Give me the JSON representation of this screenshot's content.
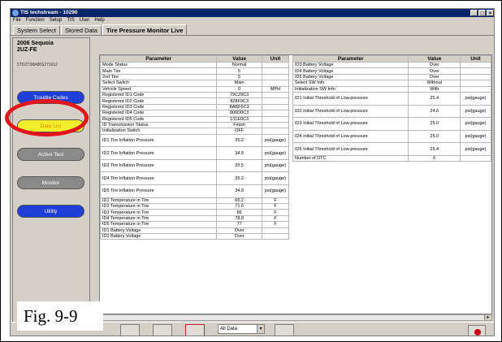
{
  "window": {
    "title": "TIS techstream - 10290"
  },
  "menu": [
    "File",
    "Function",
    "Setup",
    "TIS",
    "User",
    "Help"
  ],
  "tabs": [
    "System Select",
    "Stored Data",
    "Tire Pressure Monitor Live"
  ],
  "vehicle": {
    "name": "2006 Sequoia",
    "engine": "2UZ-FE",
    "vin": "5TDZT38A86S271612"
  },
  "side_buttons": [
    {
      "label": "Trouble Codes",
      "color": "#1f3fd8"
    },
    {
      "label": "Data List",
      "color": "#f1ef2b"
    },
    {
      "label": "Active Test",
      "color": "#8a8a8a"
    },
    {
      "label": "Monitor",
      "color": "#8a8a8a"
    },
    {
      "label": "Utility",
      "color": "#1f3fd8"
    }
  ],
  "headers": {
    "parameter": "Parameter",
    "value": "Value",
    "unit": "Unit"
  },
  "left_rows": [
    {
      "p": "Mode Status",
      "v": "Normal",
      "u": ""
    },
    {
      "p": "Main Tire",
      "v": "5",
      "u": ""
    },
    {
      "p": "2nd Tire",
      "v": "5",
      "u": ""
    },
    {
      "p": "Select Switch",
      "v": "Main",
      "u": ""
    },
    {
      "p": "Vehicle Speed",
      "v": "0",
      "u": "MPH"
    },
    {
      "p": "Registered ID1 Code",
      "v": "79C29C3",
      "u": ""
    },
    {
      "p": "Registered ID2 Code",
      "v": "828F9C3",
      "u": ""
    },
    {
      "p": "Registered ID3 Code",
      "v": "8ABF6C3",
      "u": ""
    },
    {
      "p": "Registered ID4 Code",
      "v": "806D0C3",
      "u": ""
    },
    {
      "p": "Registered ID5 Code",
      "v": "131E0C3",
      "u": ""
    },
    {
      "p": "ID Transmission Status",
      "v": "Finish",
      "u": ""
    },
    {
      "p": "Initialization Switch",
      "v": "OFF",
      "u": ""
    },
    {
      "p": "ID1 Tire Inflation Pressure",
      "v": "35.2",
      "u": "psi(gauge)",
      "tall": true
    },
    {
      "p": "ID2 Tire Inflation Pressure",
      "v": "34.8",
      "u": "psi(gauge)",
      "tall": true
    },
    {
      "p": "ID3 Tire Inflation Pressure",
      "v": "35.5",
      "u": "psi(gauge)",
      "tall": true
    },
    {
      "p": "ID4 Tire Inflation Pressure",
      "v": "35.2",
      "u": "psi(gauge)",
      "tall": true
    },
    {
      "p": "ID5 Tire Inflation Pressure",
      "v": "34.8",
      "u": "psi(gauge)",
      "tall": true
    },
    {
      "p": "ID1 Temperature in Tire",
      "v": "66.2",
      "u": "F"
    },
    {
      "p": "ID2 Temperature in Tire",
      "v": "71.6",
      "u": "F"
    },
    {
      "p": "ID3 Temperature in Tire",
      "v": "86",
      "u": "F"
    },
    {
      "p": "ID4 Temperature in Tire",
      "v": "78.8",
      "u": "F"
    },
    {
      "p": "ID5 Temperature in Tire",
      "v": "77",
      "u": "F"
    },
    {
      "p": "ID1 Battery Voltage",
      "v": "Over",
      "u": ""
    },
    {
      "p": "ID2 Battery Voltage",
      "v": "Over",
      "u": ""
    }
  ],
  "right_rows": [
    {
      "p": "ID3 Battery Voltage",
      "v": "Over",
      "u": ""
    },
    {
      "p": "ID4 Battery Voltage",
      "v": "Over",
      "u": ""
    },
    {
      "p": "ID5 Battery Voltage",
      "v": "Over",
      "u": ""
    },
    {
      "p": "Select SW Info",
      "v": "Without",
      "u": ""
    },
    {
      "p": "Initialization SW Info",
      "v": "With",
      "u": ""
    },
    {
      "p": "ID1 Initial Threshold of Low-pressure",
      "v": "25.4",
      "u": "psi(gauge)",
      "tall": true
    },
    {
      "p": "ID2 Initial Threshold of Low-pressure",
      "v": "24.6",
      "u": "psi(gauge)",
      "tall": true
    },
    {
      "p": "ID3 Initial Threshold of Low-pressure",
      "v": "25.0",
      "u": "psi(gauge)",
      "tall": true
    },
    {
      "p": "ID4 Initial Threshold of Low-pressure",
      "v": "25.0",
      "u": "psi(gauge)",
      "tall": true
    },
    {
      "p": "ID5 Initial Threshold of Low-pressure",
      "v": "25.4",
      "u": "psi(gauge)",
      "tall": true
    },
    {
      "p": "Number of DTC",
      "v": "0",
      "u": ""
    }
  ],
  "bottom": {
    "select_value": "All Data"
  },
  "figure_label": "Fig. 9-9"
}
